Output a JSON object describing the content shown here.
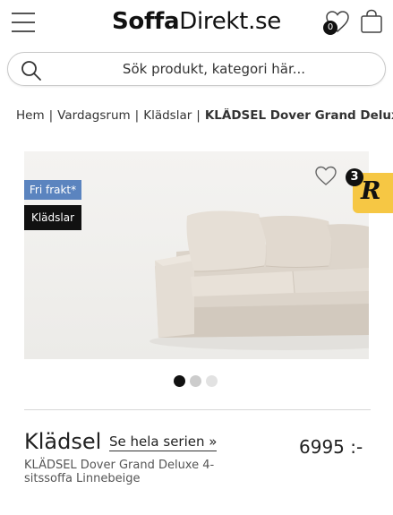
{
  "header": {
    "logo_bold": "Soffa",
    "logo_regular": "Direkt.se",
    "favorites_count": "0"
  },
  "search": {
    "placeholder": "Sök produkt, kategori här..."
  },
  "breadcrumb": {
    "items": [
      "Hem",
      "Vardagsrum",
      "Klädslar"
    ],
    "current": "KLÄDSEL Dover Grand Deluxe"
  },
  "product": {
    "tag_shipping": "Fri frakt*",
    "tag_category": "Klädslar",
    "reviews_badge_count": "3",
    "reviews_badge_letter": "R",
    "brand": "Klädsel",
    "series_link": "Se hela serien »",
    "price": "6995 :-",
    "name": "KLÄDSEL Dover Grand Deluxe 4-sitssoffa Linnebeige",
    "image_count": 3,
    "active_image": 1
  },
  "colors": {
    "shipping_tag": "#5b84bf",
    "reviews_badge": "#f6c744"
  }
}
